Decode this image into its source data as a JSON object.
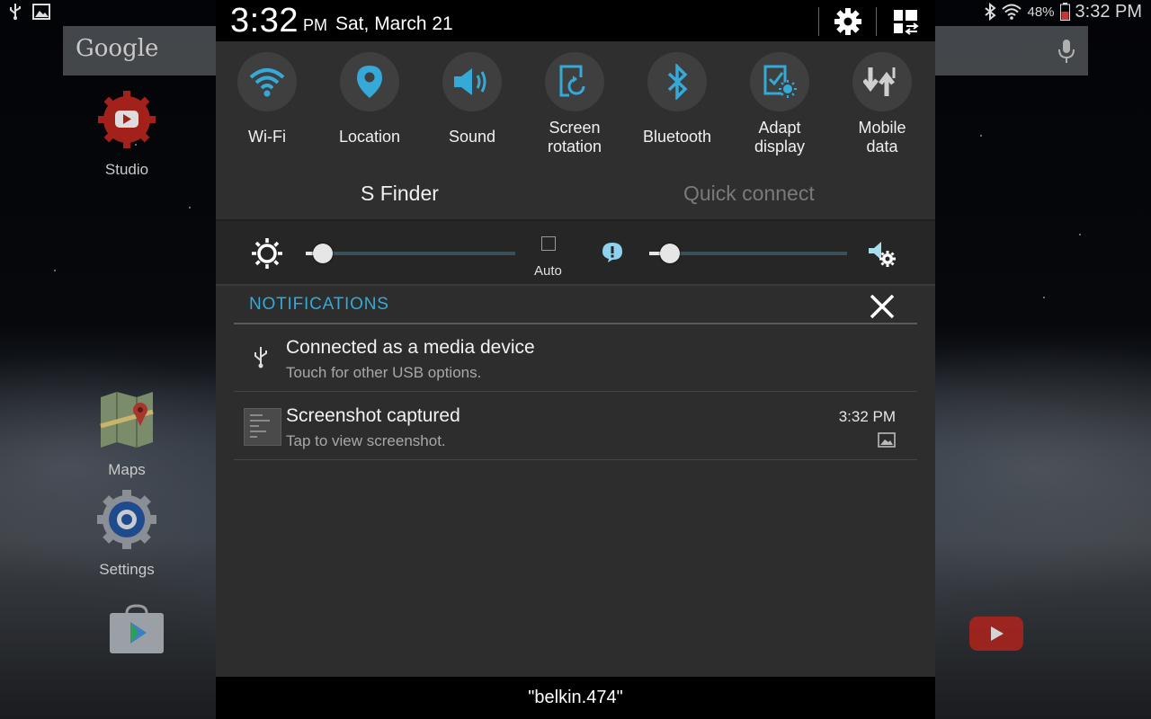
{
  "status_bar": {
    "battery": "48%",
    "time": "3:32 PM",
    "icons": [
      "usb-icon",
      "image-icon",
      "bluetooth-icon",
      "wifi-icon",
      "battery-icon"
    ]
  },
  "home_screen": {
    "search_logo": "Google",
    "apps": [
      {
        "label": "Studio"
      },
      {
        "label": "Maps"
      },
      {
        "label": "Settings"
      }
    ]
  },
  "shade": {
    "clock": "3:32",
    "ampm": "PM",
    "date": "Sat, March 21",
    "toggles": [
      {
        "label": "Wi-Fi",
        "icon": "wifi-icon",
        "active": true
      },
      {
        "label": "Location",
        "icon": "location-icon",
        "active": true
      },
      {
        "label": "Sound",
        "icon": "sound-icon",
        "active": true
      },
      {
        "label": "Screen\nrotation",
        "icon": "rotation-icon",
        "active": true
      },
      {
        "label": "Bluetooth",
        "icon": "bluetooth-icon",
        "active": true
      },
      {
        "label": "Adapt\ndisplay",
        "icon": "adapt-display-icon",
        "active": true
      },
      {
        "label": "Mobile\ndata",
        "icon": "mobile-data-icon",
        "active": false
      }
    ],
    "s_finder": "S Finder",
    "quick_connect": "Quick connect",
    "brightness": {
      "auto_label": "Auto",
      "level": 0.03,
      "auto": false
    },
    "volume": {
      "level": 0.05
    },
    "notifications_header": "NOTIFICATIONS",
    "notifications": [
      {
        "title": "Connected as a media device",
        "subtitle": "Touch for other USB options.",
        "time": ""
      },
      {
        "title": "Screenshot captured",
        "subtitle": "Tap to view screenshot.",
        "time": "3:32 PM"
      }
    ],
    "connected_network": "\"belkin.474\""
  },
  "colors": {
    "accent": "#35a9d8",
    "shade_bg": "#2d2d2d",
    "toggle_circle": "#3f3f3f",
    "inactive_icon": "#cfcfcf"
  }
}
